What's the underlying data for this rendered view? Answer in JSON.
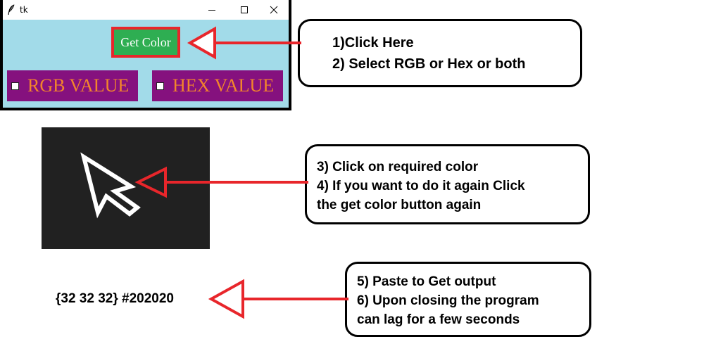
{
  "window": {
    "title": "tk",
    "controls": {
      "minimize_icon": "minimize-icon",
      "maximize_icon": "maximize-icon",
      "close_icon": "close-icon"
    },
    "client_bg": "#a2dbe9",
    "get_color_button": {
      "label": "Get Color",
      "bg": "#2eae52",
      "border": "#e8262b"
    },
    "checkboxes": [
      {
        "label": "RGB VALUE",
        "checked": false
      },
      {
        "label": "HEX VALUE",
        "checked": false
      }
    ],
    "checkbox_panel_bg": "#85117e",
    "checkbox_label_color": "#f2852b"
  },
  "cursor_preview": {
    "icon": "mouse-pointer-icon",
    "bg": "#212121"
  },
  "output": {
    "text": "{32 32 32} #202020"
  },
  "instructions": [
    {
      "lines": [
        "1)Click Here",
        "2) Select RGB or Hex or both"
      ]
    },
    {
      "lines": [
        "3) Click on required color",
        "4) If you want to do it again Click",
        "the get color button again"
      ]
    },
    {
      "lines": [
        "5) Paste to Get output",
        "6) Upon closing the program",
        "can lag for a few seconds"
      ]
    }
  ],
  "arrow_color": "#e8262b"
}
